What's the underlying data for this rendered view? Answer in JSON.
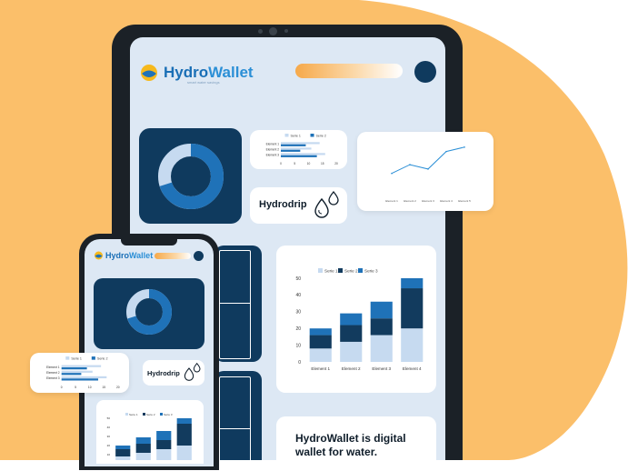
{
  "brand": {
    "name_part1": "Hydro",
    "name_part2": "Wallet",
    "tagline": "smart water savings"
  },
  "hydrodrip_label": "Hydrodrip",
  "headline_line1": "HydroWallet is digital",
  "headline_line2": "wallet for water.",
  "legend": {
    "s1": "Serie 1",
    "s2": "Serie 2",
    "s3": "Serie 3"
  },
  "hbar": {
    "labels": [
      "Element 1",
      "Element 2",
      "Element 3"
    ],
    "ticks": [
      "0",
      "5",
      "10",
      "15",
      "20"
    ]
  },
  "stacked": {
    "yticks": [
      "0",
      "10",
      "20",
      "30",
      "40",
      "50"
    ],
    "categories": [
      "Element 1",
      "Element 2",
      "Element 3",
      "Element 4"
    ]
  },
  "chart_data": [
    {
      "type": "bar",
      "orientation": "horizontal",
      "categories": [
        "Element 1",
        "Element 2",
        "Element 3"
      ],
      "series": [
        {
          "name": "Serie 1",
          "values": [
            14,
            11,
            16
          ]
        },
        {
          "name": "Serie 2",
          "values": [
            9,
            7,
            13
          ]
        }
      ],
      "xlim": [
        0,
        20
      ]
    },
    {
      "type": "line",
      "series": [
        {
          "values": [
            4,
            6,
            5,
            9,
            10
          ]
        }
      ],
      "categories": [
        "Element 1",
        "Element 2",
        "Element 3",
        "Element 4",
        "Element 5"
      ]
    },
    {
      "type": "bar",
      "stacked": true,
      "categories": [
        "Element 1",
        "Element 2",
        "Element 3",
        "Element 4"
      ],
      "series": [
        {
          "name": "Serie 1",
          "values": [
            8,
            12,
            16,
            20
          ]
        },
        {
          "name": "Serie 2",
          "values": [
            8,
            10,
            10,
            24
          ]
        },
        {
          "name": "Serie 3",
          "values": [
            4,
            7,
            10,
            6
          ]
        }
      ],
      "ylim": [
        0,
        50
      ]
    },
    {
      "type": "pie",
      "variant": "donut",
      "values": [
        70,
        30
      ]
    }
  ],
  "colors": {
    "background_blob": "#fbbf6a",
    "screen_bg": "#dde8f4",
    "dark_card": "#0f3a5e",
    "serie1": "#c6daf0",
    "serie2": "#123b5e",
    "serie3": "#1f72b8",
    "accent_blue": "#2b8fd6"
  }
}
